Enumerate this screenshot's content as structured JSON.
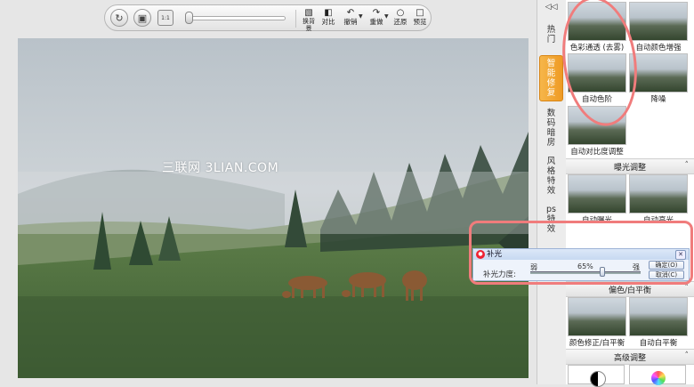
{
  "toolbar": {
    "refresh_icon": "refresh-icon",
    "monitor_icon": "monitor-icon",
    "fit_label": "1:1",
    "buttons": [
      {
        "label": "换背景"
      },
      {
        "label": "对比"
      },
      {
        "label": "撤销"
      },
      {
        "label": "重做"
      },
      {
        "label": "还原"
      },
      {
        "label": "预览"
      }
    ]
  },
  "photo": {
    "watermark": "三联网 3LIAN.COM"
  },
  "sidebar": {
    "tabs": [
      "热门",
      "智能修复",
      "数码暗房",
      "风格特效",
      "ps特效"
    ],
    "active_tab": "智能修复",
    "top_tab_icon": "collapse-icon",
    "thumbs": [
      {
        "caption": "色彩通透 (去雾)"
      },
      {
        "caption": "自动颜色增强"
      },
      {
        "caption": "自动色阶"
      },
      {
        "caption": "降噪"
      },
      {
        "caption": "自动对比度调整"
      }
    ],
    "sections": [
      {
        "label": "曝光调整"
      },
      {
        "label": "偏色/白平衡"
      },
      {
        "label": "高级调整"
      }
    ],
    "exposure_thumbs": [
      {
        "caption": "自动曝光"
      },
      {
        "caption": "自动高光"
      }
    ],
    "wb_thumbs": [
      {
        "caption": "颜色修正/白平衡"
      },
      {
        "caption": "自动白平衡"
      }
    ]
  },
  "dialog": {
    "title": "补光",
    "label": "补光力度:",
    "weak": "弱",
    "strong": "强",
    "value_text": "65%",
    "value": 65,
    "ok": "确定(O)",
    "cancel": "取消(C)"
  },
  "colors": {
    "accent_tab": "#ee9a24",
    "highlight_ring": "#f07c7c"
  }
}
